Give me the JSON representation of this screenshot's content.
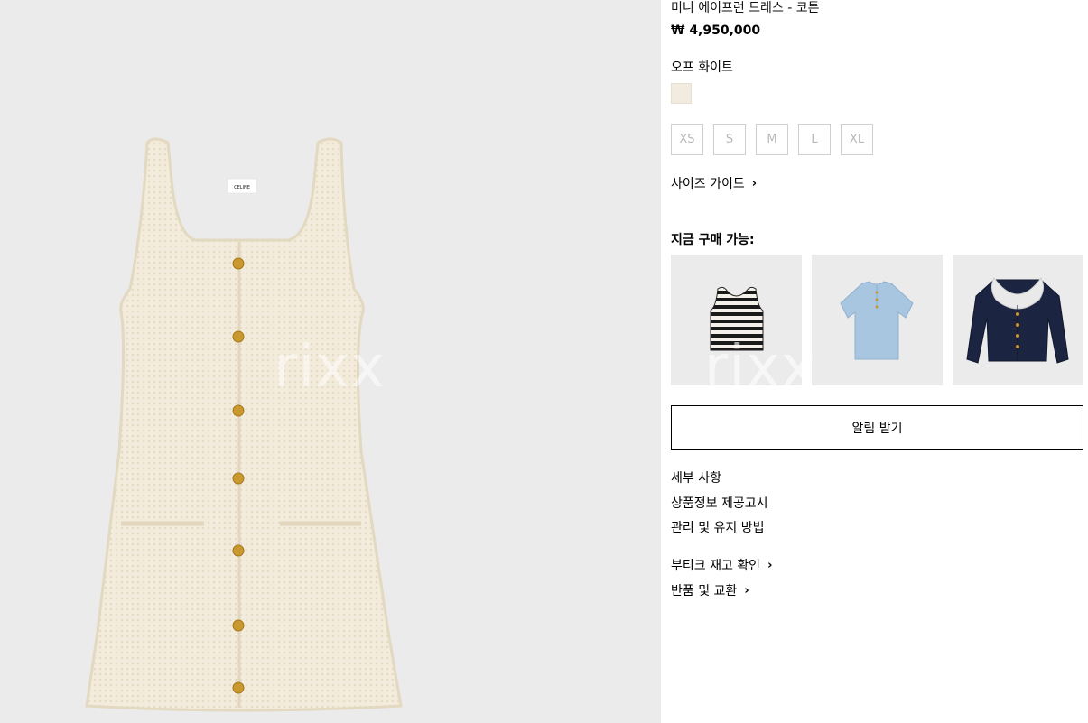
{
  "product": {
    "name": "미니 에이프런 드레스 - 코튼",
    "price": "₩ 4,950,000",
    "color_label": "오프 화이트",
    "swatch_color": "#f2ece0",
    "sizes": [
      "XS",
      "S",
      "M",
      "L",
      "XL"
    ],
    "size_guide": "사이즈 가이드",
    "hero_image": "cream-knit-sleeveless-dress",
    "label_text": "CELINE"
  },
  "available": {
    "title": "지금 구매 가능:",
    "items": [
      {
        "image": "striped-tank-top"
      },
      {
        "image": "light-blue-knit-polo"
      },
      {
        "image": "navy-cardigan-lace-collar"
      }
    ]
  },
  "notify_button": "알림 받기",
  "info_links": [
    "세부 사항",
    "상품정보 제공고시",
    "관리 및 유지 방법"
  ],
  "action_links": [
    "부티크 재고 확인",
    "반품 및 교환"
  ],
  "watermark": "rixx",
  "colors": {
    "hero_bg": "#ebebeb",
    "dress": "#f3ecdc",
    "button_gold": "#c9992f"
  }
}
